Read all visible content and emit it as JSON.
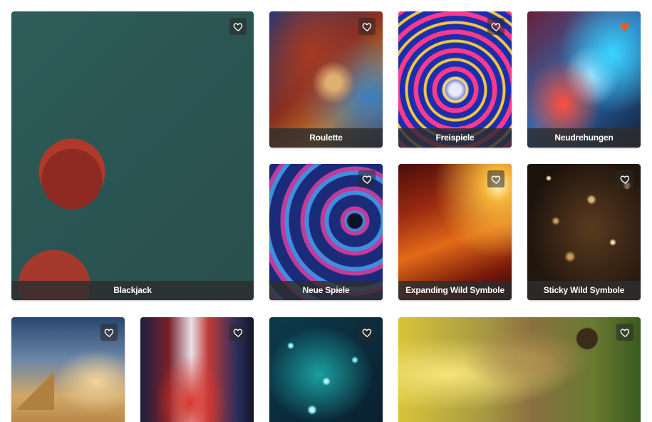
{
  "colors": {
    "favorite_active": "#ea5a2a",
    "favorite_inactive": "#ffffff",
    "label_bar": "#2d2d2d"
  },
  "tiles": [
    {
      "label": "Blackjack",
      "favorite": false
    },
    {
      "label": "Roulette",
      "favorite": false
    },
    {
      "label": "Freispiele",
      "favorite": false
    },
    {
      "label": "Neudrehungen",
      "favorite": true
    },
    {
      "label": "Neue Spiele",
      "favorite": false
    },
    {
      "label": "Expanding Wild Symbole",
      "favorite": false
    },
    {
      "label": "Sticky Wild Symbole",
      "favorite": false
    },
    {
      "label": "",
      "favorite": false
    },
    {
      "label": "",
      "favorite": false
    },
    {
      "label": "",
      "favorite": false
    },
    {
      "label": "",
      "favorite": false
    }
  ],
  "icons": {
    "favorite": "heart-icon"
  }
}
